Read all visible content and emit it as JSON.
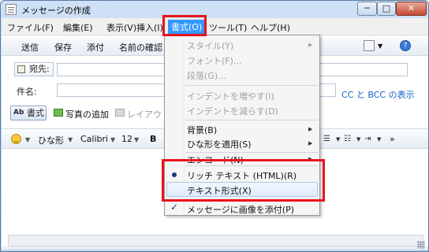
{
  "window": {
    "title": "メッセージの作成",
    "buttons": {
      "minimize": "─",
      "maximize": "□",
      "close": "✕"
    }
  },
  "menubar": {
    "items": [
      {
        "label": "ファイル(F)"
      },
      {
        "label": "編集(E)"
      },
      {
        "label": "表示(V)"
      },
      {
        "label": "挿入(I)"
      },
      {
        "label": "書式(O)",
        "active": true
      },
      {
        "label": "ツール(T)"
      },
      {
        "label": "ヘルプ(H)"
      }
    ]
  },
  "toolbar": {
    "send": "送信",
    "save": "保存",
    "attach": "添付",
    "check_names": "名前の確認"
  },
  "header_fields": {
    "to_label": "宛先:",
    "to_value": "",
    "subject_label": "件名:",
    "subject_value": "",
    "cc_bcc_link": "CC と BCC の表示"
  },
  "compose_toolbar": {
    "format": "書式",
    "add_photo": "写真の追加",
    "layout": "レイアウト"
  },
  "format_toolbar": {
    "stationery": "ひな形",
    "font_name": "Calibri",
    "font_size": "12",
    "bold": "B",
    "more": "»"
  },
  "format_menu": {
    "items": [
      {
        "label": "スタイル(Y)",
        "disabled": true,
        "submenu": true
      },
      {
        "label": "フォント(F)...",
        "disabled": true
      },
      {
        "label": "段落(G)...",
        "disabled": true
      },
      {
        "label": "インデントを増やす(I)",
        "disabled": true
      },
      {
        "label": "インデントを減らす(D)",
        "disabled": true
      },
      {
        "label": "背景(B)",
        "disabled": false,
        "submenu": true
      },
      {
        "label": "ひな形を適用(S)",
        "disabled": false,
        "submenu": true
      },
      {
        "label": "エンコード(N)",
        "disabled": false,
        "submenu": true
      },
      {
        "label": "リッチ テキスト (HTML)(R)",
        "disabled": false,
        "selected": true
      },
      {
        "label": "テキスト形式(X)",
        "disabled": false,
        "hovered": true
      },
      {
        "label": "メッセージに画像を添付(P)",
        "disabled": false,
        "checked": true
      }
    ]
  },
  "colors": {
    "highlight": "#e8141b",
    "menu_active": "#3399ff",
    "link": "#1560c2"
  }
}
